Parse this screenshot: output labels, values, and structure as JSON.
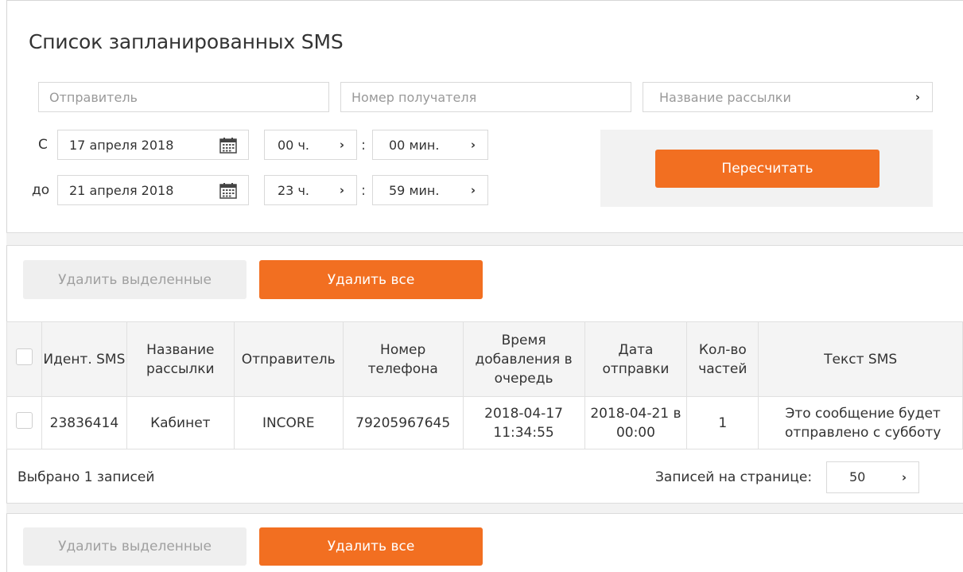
{
  "page": {
    "title": "Список запланированных SMS"
  },
  "filters": {
    "sender_placeholder": "Отправитель",
    "recipient_placeholder": "Номер получателя",
    "campaign_placeholder": "Название рассылки",
    "from_label": "С",
    "to_label": "до",
    "from_date": "17 апреля 2018",
    "to_date": "21 апреля 2018",
    "from_hour": "00 ч.",
    "from_minute": "00 мин.",
    "to_hour": "23 ч.",
    "to_minute": "59 мин.",
    "colon": ":",
    "recalc_label": "Пересчитать"
  },
  "actions": {
    "delete_selected": "Удалить выделенные",
    "delete_all": "Удалить все"
  },
  "table": {
    "headers": [
      "Идент. SMS",
      "Название рассылки",
      "Отправитель",
      "Номер телефона",
      "Время добавления в очередь",
      "Дата отправки",
      "Кол-во частей",
      "Текст SMS"
    ],
    "rows": [
      {
        "id": "23836414",
        "campaign": "Кабинет",
        "sender": "INCORE",
        "phone": "79205967645",
        "queued_time": "2018-04-17 11:34:55",
        "send_date": "2018-04-21 в 00:00",
        "parts": "1",
        "text": "Это сообщение будет отправлено с субботу"
      }
    ]
  },
  "footer": {
    "selected_count": "Выбрано 1 записей",
    "per_page_label": "Записей на странице:",
    "per_page_value": "50"
  },
  "icons": {
    "arrow": "›",
    "chevron": "chevron-right-icon",
    "calendar": "calendar-icon"
  },
  "colors": {
    "accent": "#f26f21",
    "panel": "#f2f2f2",
    "border": "#d9d9d9"
  }
}
